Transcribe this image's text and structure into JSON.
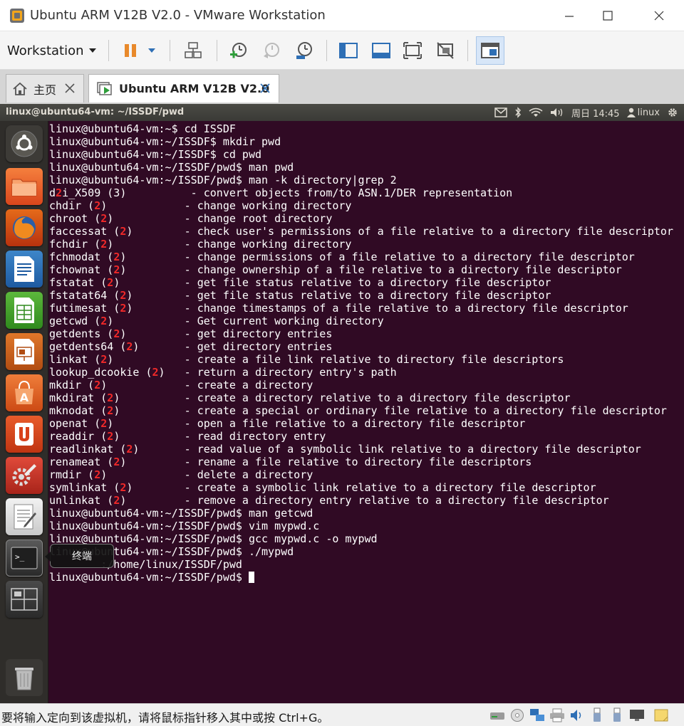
{
  "window": {
    "title": "Ubuntu ARM V12B V2.0 - VMware Workstation"
  },
  "toolbar": {
    "workstation_label": "Workstation"
  },
  "tabs": [
    {
      "label": "主页"
    },
    {
      "label": "Ubuntu ARM V12B V2.0"
    }
  ],
  "guest_panel": {
    "window_title": "linux@ubuntu64-vm: ~/ISSDF/pwd",
    "clock": "周日 14:45",
    "user": "linux"
  },
  "launcher": {
    "tooltip": "终端"
  },
  "terminal": {
    "lines": [
      {
        "text": "linux@ubuntu64-vm:~$ cd ISSDF"
      },
      {
        "text": "linux@ubuntu64-vm:~/ISSDF$ mkdir pwd"
      },
      {
        "text": "linux@ubuntu64-vm:~/ISSDF$ cd pwd"
      },
      {
        "text": "linux@ubuntu64-vm:~/ISSDF/pwd$ man pwd"
      },
      {
        "text": "linux@ubuntu64-vm:~/ISSDF/pwd$ man -k directory|grep 2"
      },
      {
        "pre": "d",
        "num": "2",
        "post": "i_X509 (3)          - convert objects from/to ASN.1/DER representation"
      },
      {
        "pre": "chdir (",
        "num": "2",
        "post": ")            - change working directory"
      },
      {
        "pre": "chroot (",
        "num": "2",
        "post": ")           - change root directory"
      },
      {
        "pre": "faccessat (",
        "num": "2",
        "post": ")        - check user's permissions of a file relative to a directory file descriptor"
      },
      {
        "pre": "fchdir (",
        "num": "2",
        "post": ")           - change working directory"
      },
      {
        "pre": "fchmodat (",
        "num": "2",
        "post": ")         - change permissions of a file relative to a directory file descriptor"
      },
      {
        "pre": "fchownat (",
        "num": "2",
        "post": ")         - change ownership of a file relative to a directory file descriptor"
      },
      {
        "pre": "fstatat (",
        "num": "2",
        "post": ")          - get file status relative to a directory file descriptor"
      },
      {
        "pre": "fstatat64 (",
        "num": "2",
        "post": ")        - get file status relative to a directory file descriptor"
      },
      {
        "pre": "futimesat (",
        "num": "2",
        "post": ")        - change timestamps of a file relative to a directory file descriptor"
      },
      {
        "pre": "getcwd (",
        "num": "2",
        "post": ")           - Get current working directory"
      },
      {
        "pre": "getdents (",
        "num": "2",
        "post": ")         - get directory entries"
      },
      {
        "pre": "getdents64 (",
        "num": "2",
        "post": ")       - get directory entries"
      },
      {
        "pre": "linkat (",
        "num": "2",
        "post": ")           - create a file link relative to directory file descriptors"
      },
      {
        "pre": "lookup_dcookie (",
        "num": "2",
        "post": ")   - return a directory entry's path"
      },
      {
        "pre": "mkdir (",
        "num": "2",
        "post": ")            - create a directory"
      },
      {
        "pre": "mkdirat (",
        "num": "2",
        "post": ")          - create a directory relative to a directory file descriptor"
      },
      {
        "pre": "mknodat (",
        "num": "2",
        "post": ")          - create a special or ordinary file relative to a directory file descriptor"
      },
      {
        "pre": "openat (",
        "num": "2",
        "post": ")           - open a file relative to a directory file descriptor"
      },
      {
        "pre": "readdir (",
        "num": "2",
        "post": ")          - read directory entry"
      },
      {
        "pre": "readlinkat (",
        "num": "2",
        "post": ")       - read value of a symbolic link relative to a directory file descriptor"
      },
      {
        "pre": "renameat (",
        "num": "2",
        "post": ")         - rename a file relative to directory file descriptors"
      },
      {
        "pre": "rmdir (",
        "num": "2",
        "post": ")            - delete a directory"
      },
      {
        "pre": "symlinkat (",
        "num": "2",
        "post": ")        - create a symbolic link relative to a directory file descriptor"
      },
      {
        "pre": "unlinkat (",
        "num": "2",
        "post": ")         - remove a directory entry relative to a directory file descriptor"
      },
      {
        "text": "linux@ubuntu64-vm:~/ISSDF/pwd$ man getcwd"
      },
      {
        "text": "linux@ubuntu64-vm:~/ISSDF/pwd$ vim mypwd.c"
      },
      {
        "text": "linux@ubuntu64-vm:~/ISSDF/pwd$ gcc mypwd.c -o mypwd"
      },
      {
        "text": "linux@ubuntu64-vm:~/ISSDF/pwd$ ./mypwd"
      },
      {
        "text": "        :/home/linux/ISSDF/pwd"
      },
      {
        "text": "linux@ubuntu64-vm:~/ISSDF/pwd$ ",
        "cursor": true
      }
    ]
  },
  "statusbar": {
    "message": "要将输入定向到该虚拟机，请将鼠标指针移入其中或按 Ctrl+G。"
  },
  "colors": {
    "terminal_bg": "#300a24",
    "terminal_fg": "#ffffff",
    "highlight_red": "#ef2929",
    "launcher_bg": "#2f2d2a",
    "panel_bg": "#3c3b37",
    "toolbar_accent": "#e8892b",
    "toolbar_blue": "#2e6fb5"
  }
}
